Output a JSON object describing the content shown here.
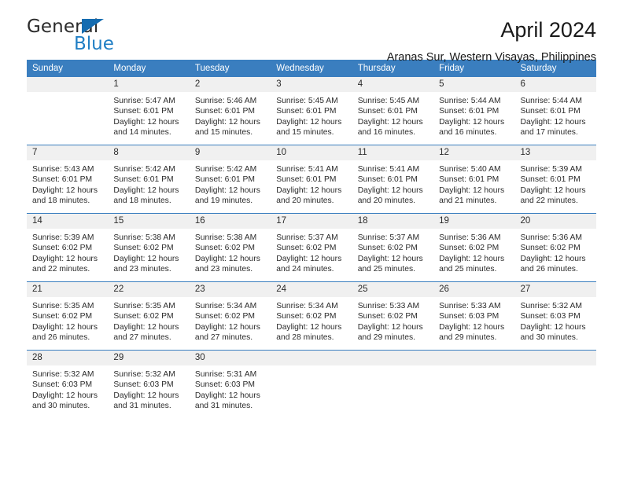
{
  "brand": {
    "name_part1": "General",
    "name_part2": "Blue",
    "accent_color": "#1f7ec4",
    "triangle_color": "#156cb0"
  },
  "header": {
    "month_title": "April 2024",
    "location": "Aranas Sur, Western Visayas, Philippines",
    "header_bg_color": "#3a7ebf",
    "daynum_bg_color": "#f0f0f0"
  },
  "weekday_headers": [
    "Sunday",
    "Monday",
    "Tuesday",
    "Wednesday",
    "Thursday",
    "Friday",
    "Saturday"
  ],
  "weeks": [
    [
      {
        "day": "",
        "sunrise": "",
        "sunset": "",
        "daylight_line1": "",
        "daylight_line2": ""
      },
      {
        "day": "1",
        "sunrise": "Sunrise: 5:47 AM",
        "sunset": "Sunset: 6:01 PM",
        "daylight_line1": "Daylight: 12 hours",
        "daylight_line2": "and 14 minutes."
      },
      {
        "day": "2",
        "sunrise": "Sunrise: 5:46 AM",
        "sunset": "Sunset: 6:01 PM",
        "daylight_line1": "Daylight: 12 hours",
        "daylight_line2": "and 15 minutes."
      },
      {
        "day": "3",
        "sunrise": "Sunrise: 5:45 AM",
        "sunset": "Sunset: 6:01 PM",
        "daylight_line1": "Daylight: 12 hours",
        "daylight_line2": "and 15 minutes."
      },
      {
        "day": "4",
        "sunrise": "Sunrise: 5:45 AM",
        "sunset": "Sunset: 6:01 PM",
        "daylight_line1": "Daylight: 12 hours",
        "daylight_line2": "and 16 minutes."
      },
      {
        "day": "5",
        "sunrise": "Sunrise: 5:44 AM",
        "sunset": "Sunset: 6:01 PM",
        "daylight_line1": "Daylight: 12 hours",
        "daylight_line2": "and 16 minutes."
      },
      {
        "day": "6",
        "sunrise": "Sunrise: 5:44 AM",
        "sunset": "Sunset: 6:01 PM",
        "daylight_line1": "Daylight: 12 hours",
        "daylight_line2": "and 17 minutes."
      }
    ],
    [
      {
        "day": "7",
        "sunrise": "Sunrise: 5:43 AM",
        "sunset": "Sunset: 6:01 PM",
        "daylight_line1": "Daylight: 12 hours",
        "daylight_line2": "and 18 minutes."
      },
      {
        "day": "8",
        "sunrise": "Sunrise: 5:42 AM",
        "sunset": "Sunset: 6:01 PM",
        "daylight_line1": "Daylight: 12 hours",
        "daylight_line2": "and 18 minutes."
      },
      {
        "day": "9",
        "sunrise": "Sunrise: 5:42 AM",
        "sunset": "Sunset: 6:01 PM",
        "daylight_line1": "Daylight: 12 hours",
        "daylight_line2": "and 19 minutes."
      },
      {
        "day": "10",
        "sunrise": "Sunrise: 5:41 AM",
        "sunset": "Sunset: 6:01 PM",
        "daylight_line1": "Daylight: 12 hours",
        "daylight_line2": "and 20 minutes."
      },
      {
        "day": "11",
        "sunrise": "Sunrise: 5:41 AM",
        "sunset": "Sunset: 6:01 PM",
        "daylight_line1": "Daylight: 12 hours",
        "daylight_line2": "and 20 minutes."
      },
      {
        "day": "12",
        "sunrise": "Sunrise: 5:40 AM",
        "sunset": "Sunset: 6:01 PM",
        "daylight_line1": "Daylight: 12 hours",
        "daylight_line2": "and 21 minutes."
      },
      {
        "day": "13",
        "sunrise": "Sunrise: 5:39 AM",
        "sunset": "Sunset: 6:01 PM",
        "daylight_line1": "Daylight: 12 hours",
        "daylight_line2": "and 22 minutes."
      }
    ],
    [
      {
        "day": "14",
        "sunrise": "Sunrise: 5:39 AM",
        "sunset": "Sunset: 6:02 PM",
        "daylight_line1": "Daylight: 12 hours",
        "daylight_line2": "and 22 minutes."
      },
      {
        "day": "15",
        "sunrise": "Sunrise: 5:38 AM",
        "sunset": "Sunset: 6:02 PM",
        "daylight_line1": "Daylight: 12 hours",
        "daylight_line2": "and 23 minutes."
      },
      {
        "day": "16",
        "sunrise": "Sunrise: 5:38 AM",
        "sunset": "Sunset: 6:02 PM",
        "daylight_line1": "Daylight: 12 hours",
        "daylight_line2": "and 23 minutes."
      },
      {
        "day": "17",
        "sunrise": "Sunrise: 5:37 AM",
        "sunset": "Sunset: 6:02 PM",
        "daylight_line1": "Daylight: 12 hours",
        "daylight_line2": "and 24 minutes."
      },
      {
        "day": "18",
        "sunrise": "Sunrise: 5:37 AM",
        "sunset": "Sunset: 6:02 PM",
        "daylight_line1": "Daylight: 12 hours",
        "daylight_line2": "and 25 minutes."
      },
      {
        "day": "19",
        "sunrise": "Sunrise: 5:36 AM",
        "sunset": "Sunset: 6:02 PM",
        "daylight_line1": "Daylight: 12 hours",
        "daylight_line2": "and 25 minutes."
      },
      {
        "day": "20",
        "sunrise": "Sunrise: 5:36 AM",
        "sunset": "Sunset: 6:02 PM",
        "daylight_line1": "Daylight: 12 hours",
        "daylight_line2": "and 26 minutes."
      }
    ],
    [
      {
        "day": "21",
        "sunrise": "Sunrise: 5:35 AM",
        "sunset": "Sunset: 6:02 PM",
        "daylight_line1": "Daylight: 12 hours",
        "daylight_line2": "and 26 minutes."
      },
      {
        "day": "22",
        "sunrise": "Sunrise: 5:35 AM",
        "sunset": "Sunset: 6:02 PM",
        "daylight_line1": "Daylight: 12 hours",
        "daylight_line2": "and 27 minutes."
      },
      {
        "day": "23",
        "sunrise": "Sunrise: 5:34 AM",
        "sunset": "Sunset: 6:02 PM",
        "daylight_line1": "Daylight: 12 hours",
        "daylight_line2": "and 27 minutes."
      },
      {
        "day": "24",
        "sunrise": "Sunrise: 5:34 AM",
        "sunset": "Sunset: 6:02 PM",
        "daylight_line1": "Daylight: 12 hours",
        "daylight_line2": "and 28 minutes."
      },
      {
        "day": "25",
        "sunrise": "Sunrise: 5:33 AM",
        "sunset": "Sunset: 6:02 PM",
        "daylight_line1": "Daylight: 12 hours",
        "daylight_line2": "and 29 minutes."
      },
      {
        "day": "26",
        "sunrise": "Sunrise: 5:33 AM",
        "sunset": "Sunset: 6:03 PM",
        "daylight_line1": "Daylight: 12 hours",
        "daylight_line2": "and 29 minutes."
      },
      {
        "day": "27",
        "sunrise": "Sunrise: 5:32 AM",
        "sunset": "Sunset: 6:03 PM",
        "daylight_line1": "Daylight: 12 hours",
        "daylight_line2": "and 30 minutes."
      }
    ],
    [
      {
        "day": "28",
        "sunrise": "Sunrise: 5:32 AM",
        "sunset": "Sunset: 6:03 PM",
        "daylight_line1": "Daylight: 12 hours",
        "daylight_line2": "and 30 minutes."
      },
      {
        "day": "29",
        "sunrise": "Sunrise: 5:32 AM",
        "sunset": "Sunset: 6:03 PM",
        "daylight_line1": "Daylight: 12 hours",
        "daylight_line2": "and 31 minutes."
      },
      {
        "day": "30",
        "sunrise": "Sunrise: 5:31 AM",
        "sunset": "Sunset: 6:03 PM",
        "daylight_line1": "Daylight: 12 hours",
        "daylight_line2": "and 31 minutes."
      },
      {
        "day": "",
        "sunrise": "",
        "sunset": "",
        "daylight_line1": "",
        "daylight_line2": ""
      },
      {
        "day": "",
        "sunrise": "",
        "sunset": "",
        "daylight_line1": "",
        "daylight_line2": ""
      },
      {
        "day": "",
        "sunrise": "",
        "sunset": "",
        "daylight_line1": "",
        "daylight_line2": ""
      },
      {
        "day": "",
        "sunrise": "",
        "sunset": "",
        "daylight_line1": "",
        "daylight_line2": ""
      }
    ]
  ]
}
